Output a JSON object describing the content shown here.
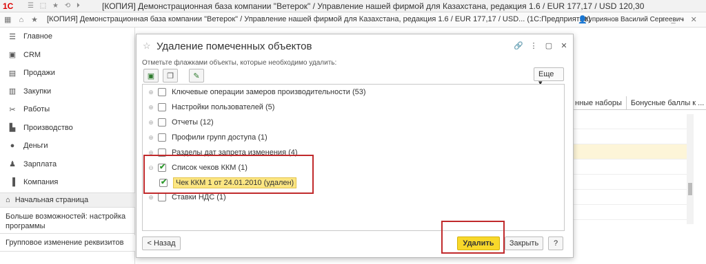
{
  "app": {
    "logo": "1С",
    "window_title": "[КОПИЯ] Демонстрационная база компании \"Ветерок\" / Управление нашей фирмой для Казахстана, редакция 1.6 / EUR 177,17 / USD 120,30",
    "inner_title": "[КОПИЯ] Демонстрационная база компании \"Ветерок\" / Управление нашей фирмой для Казахстана, редакция 1.6 / EUR 177,17 / USD...  (1С:Предприятие)",
    "user": "Куприянов Василий Сергеевич"
  },
  "sidebar": {
    "items": [
      {
        "label": "Главное",
        "icon": "menu-icon"
      },
      {
        "label": "CRM",
        "icon": "crm-icon"
      },
      {
        "label": "Продажи",
        "icon": "sales-icon"
      },
      {
        "label": "Закупки",
        "icon": "purchases-icon"
      },
      {
        "label": "Работы",
        "icon": "tools-icon"
      },
      {
        "label": "Производство",
        "icon": "factory-icon"
      },
      {
        "label": "Деньги",
        "icon": "money-icon"
      },
      {
        "label": "Зарплата",
        "icon": "salary-icon"
      },
      {
        "label": "Компания",
        "icon": "company-icon"
      }
    ],
    "home_label": "Начальная страница",
    "more_label": "Больше возможностей: настройка программы",
    "group_label": "Групповое изменение реквизитов"
  },
  "background": {
    "tab1": "нные наборы",
    "tab2": "Бонусные баллы к ..."
  },
  "dialog": {
    "title": "Удаление помеченных объектов",
    "hint": "Отметьте флажками объекты, которые необходимо удалить:",
    "more_label": "Еще",
    "tree": [
      {
        "label": "Ключевые операции замеров производительности (53)",
        "checked": false,
        "expanded": false
      },
      {
        "label": "Настройки пользователей (5)",
        "checked": false,
        "expanded": false
      },
      {
        "label": "Отчеты (12)",
        "checked": false,
        "expanded": false
      },
      {
        "label": "Профили групп доступа (1)",
        "checked": false,
        "expanded": false
      },
      {
        "label": "Разделы дат запрета изменения (4)",
        "checked": false,
        "expanded": false
      },
      {
        "label": "Список чеков ККМ (1)",
        "checked": true,
        "expanded": true
      },
      {
        "label": "Чек ККМ 1 от 24.01.2010 (удален)",
        "checked": true,
        "child": true
      },
      {
        "label": "Ставки НДС (1)",
        "checked": false,
        "expanded": false
      }
    ],
    "back_label": "< Назад",
    "delete_label": "Удалить",
    "close_label": "Закрыть",
    "help_label": "?"
  }
}
